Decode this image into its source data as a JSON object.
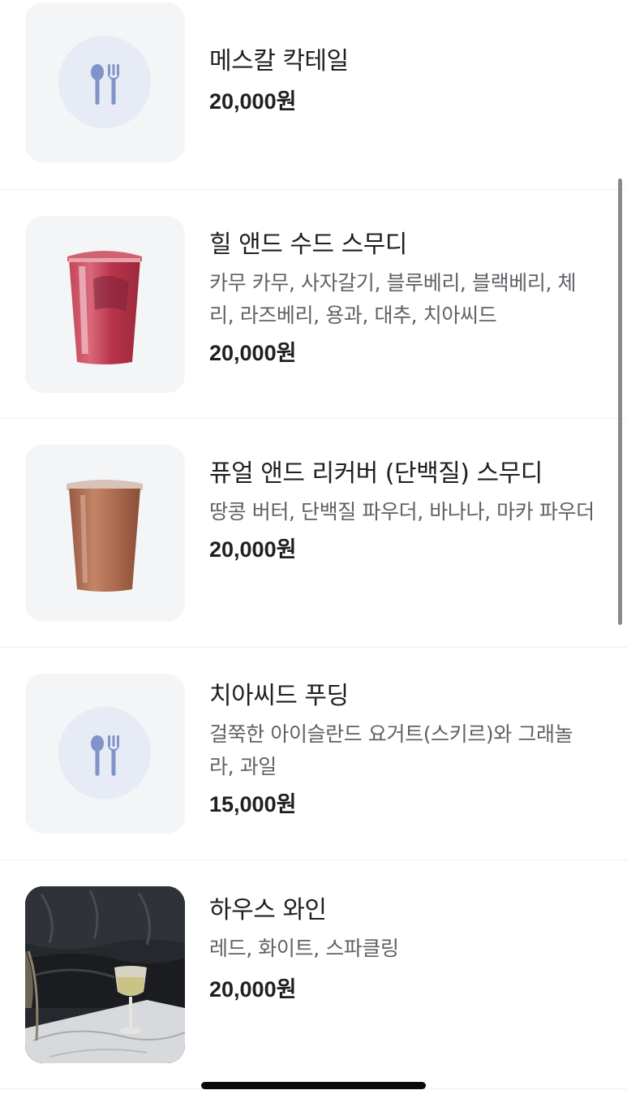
{
  "menu": {
    "items": [
      {
        "name": "메스칼 칵테일",
        "description": "",
        "price": "20,000원",
        "image": "utensils-placeholder-icon"
      },
      {
        "name": "힐 앤드 수드 스무디",
        "description": "카무 카무, 사자갈기, 블루베리, 블랙베리, 체리, 라즈베리, 용과, 대추, 치아씨드",
        "price": "20,000원",
        "image": "berry-smoothie-cup"
      },
      {
        "name": "퓨얼 앤드 리커버 (단백질) 스무디",
        "description": "땅콩 버터, 단백질 파우더, 바나나, 마카 파우더",
        "price": "20,000원",
        "image": "protein-smoothie-cup"
      },
      {
        "name": "치아씨드 푸딩",
        "description": "걸쭉한 아이슬란드 요거트(스키르)와 그래놀라, 과일",
        "price": "15,000원",
        "image": "utensils-placeholder-icon"
      },
      {
        "name": "하우스 와인",
        "description": "레드, 화이트, 스파클링",
        "price": "20,000원",
        "image": "wine-glass-photo"
      }
    ]
  },
  "colors": {
    "text_primary": "#1f1f1f",
    "text_secondary": "#5f6166",
    "thumb_bg": "#f4f5f7",
    "placeholder_icon": "#8193c8",
    "divider": "#eeeff1"
  }
}
